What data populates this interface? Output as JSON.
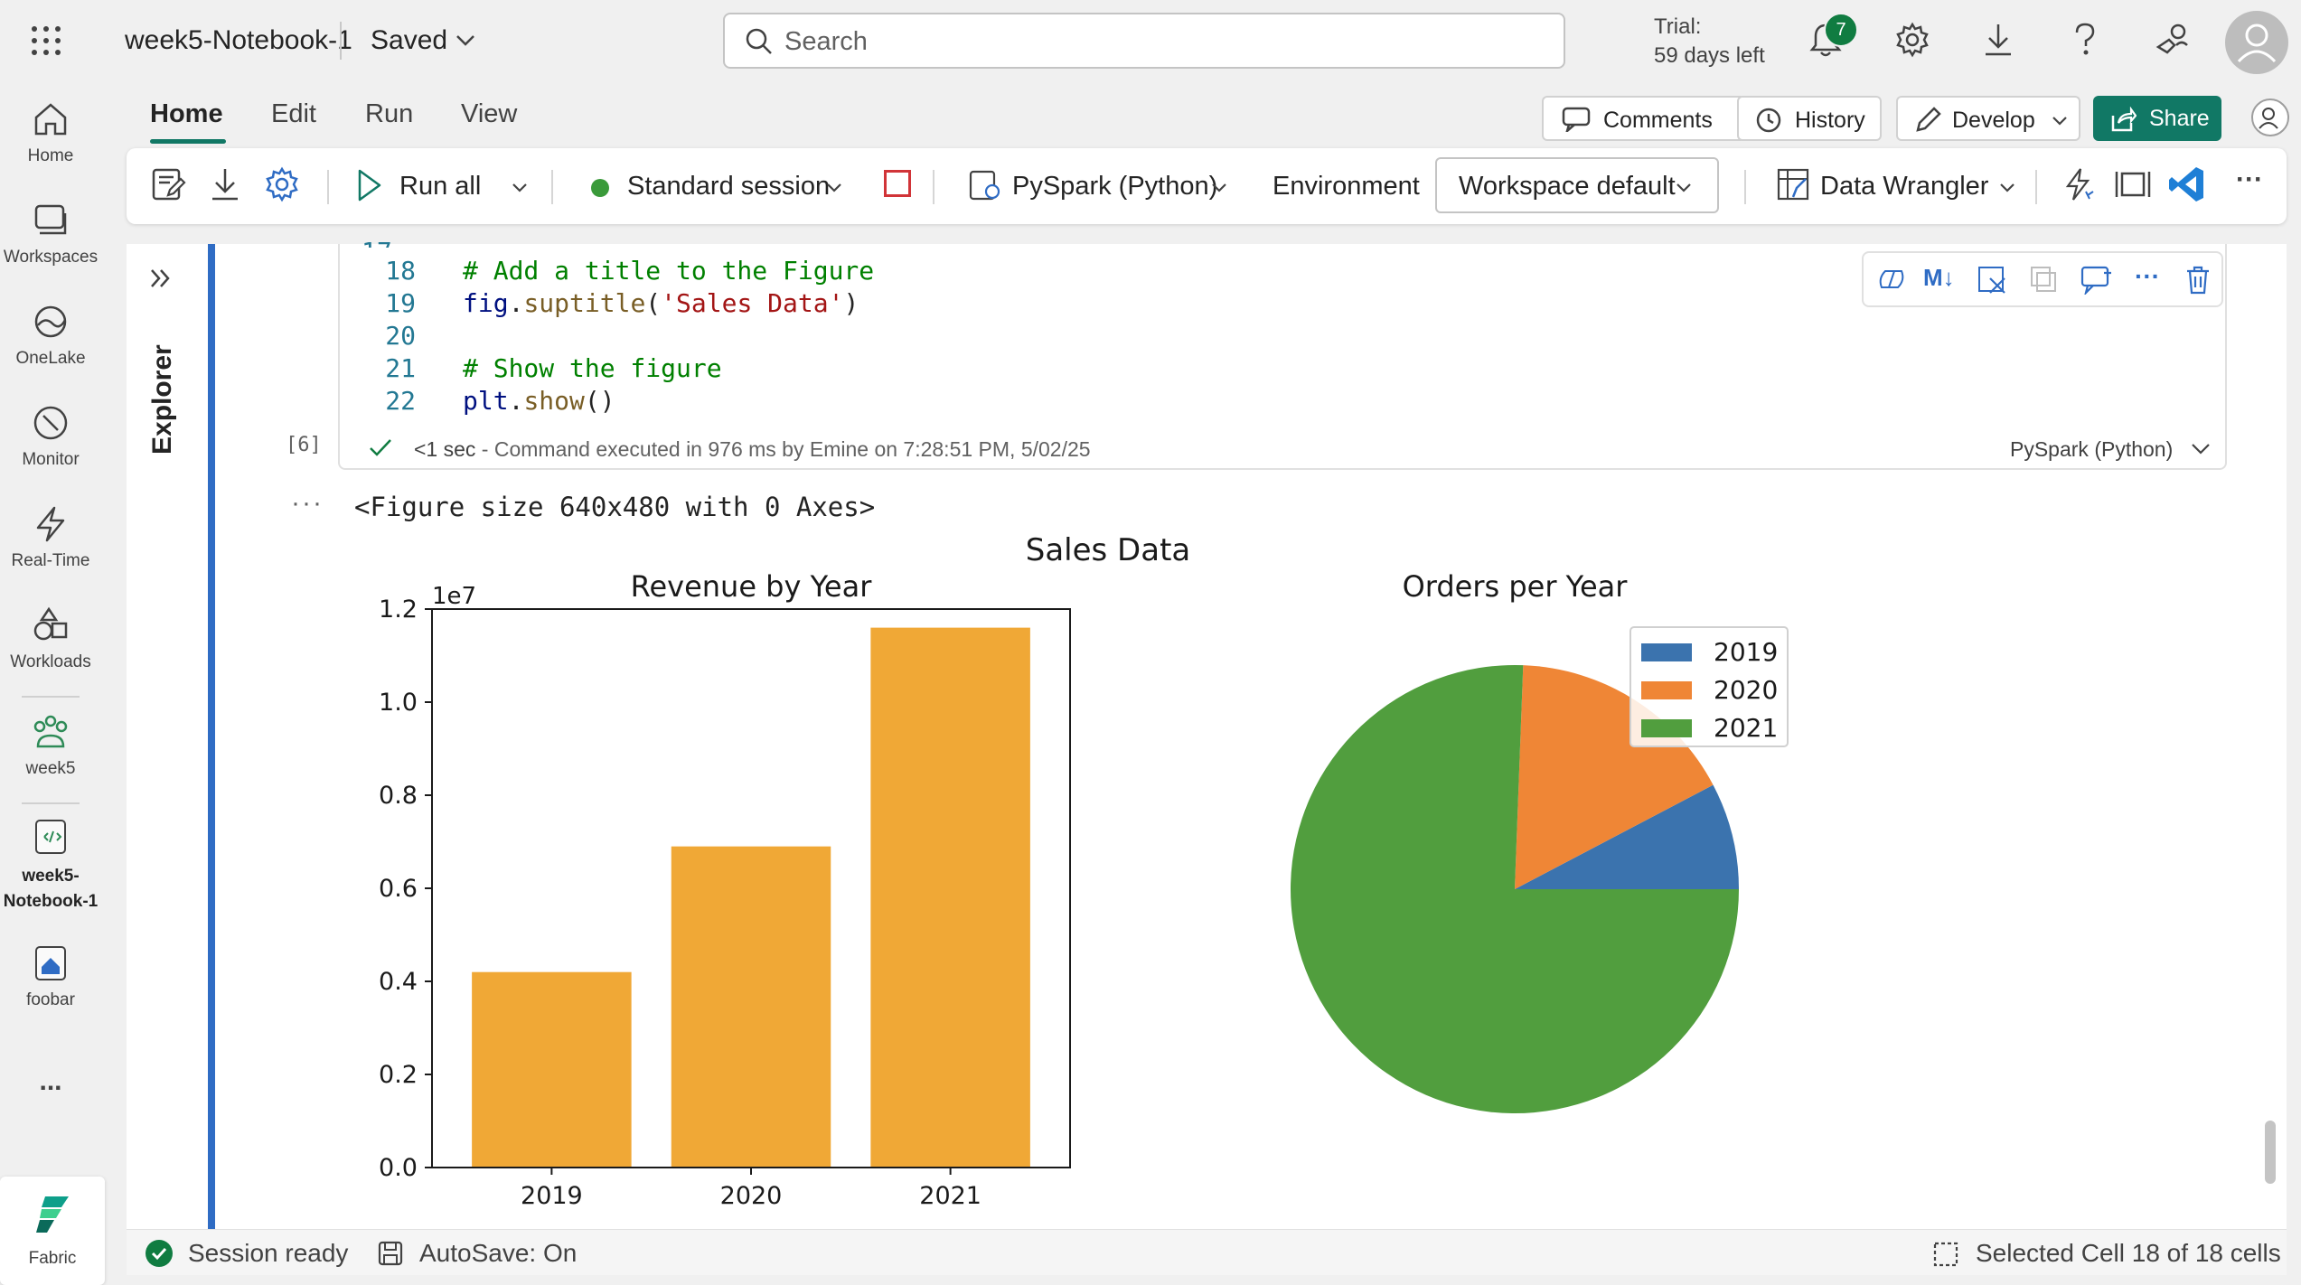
{
  "app": {
    "notebook_name": "week5-Notebook-1",
    "save_state": "Saved",
    "search_placeholder": "Search",
    "trial_line1": "Trial:",
    "trial_line2": "59 days left",
    "notification_count": "7"
  },
  "rail": {
    "items": [
      {
        "label": "Home",
        "icon": "home-icon"
      },
      {
        "label": "Workspaces",
        "icon": "workspaces-icon"
      },
      {
        "label": "OneLake",
        "icon": "onelake-icon"
      },
      {
        "label": "Monitor",
        "icon": "monitor-icon"
      },
      {
        "label": "Real-Time",
        "icon": "realtime-icon"
      },
      {
        "label": "Workloads",
        "icon": "workloads-icon"
      },
      {
        "label": "week5",
        "icon": "workspace-people-icon"
      },
      {
        "label": "week5-\nNotebook-1",
        "icon": "notebook-icon"
      },
      {
        "label": "foobar",
        "icon": "lakehouse-icon"
      }
    ],
    "more": "...",
    "fabric_label": "Fabric"
  },
  "ribbon": {
    "tabs": [
      "Home",
      "Edit",
      "Run",
      "View"
    ],
    "active_tab": "Home",
    "comments": "Comments",
    "history": "History",
    "develop": "Develop",
    "share": "Share"
  },
  "toolbar": {
    "run_all": "Run all",
    "session": "Standard session",
    "language": "PySpark (Python)",
    "environment": "Environment",
    "workspace": "Workspace default",
    "data_wrangler": "Data Wrangler",
    "session_status_color": "#3a9a3a"
  },
  "explorer": {
    "label": "Explorer"
  },
  "cell": {
    "lines": [
      {
        "no": "18",
        "parts": [
          {
            "t": "# Add a title to the Figure",
            "c": "cm"
          }
        ]
      },
      {
        "no": "19",
        "parts": [
          {
            "t": "fig",
            "c": "var"
          },
          {
            "t": ".",
            "c": ""
          },
          {
            "t": "suptitle",
            "c": "fn"
          },
          {
            "t": "(",
            "c": ""
          },
          {
            "t": "'Sales Data'",
            "c": "st"
          },
          {
            "t": ")",
            "c": ""
          }
        ]
      },
      {
        "no": "20",
        "parts": []
      },
      {
        "no": "21",
        "parts": [
          {
            "t": "# Show the figure",
            "c": "cm"
          }
        ]
      },
      {
        "no": "22",
        "parts": [
          {
            "t": "plt",
            "c": "var"
          },
          {
            "t": ".",
            "c": ""
          },
          {
            "t": "show",
            "c": "fn"
          },
          {
            "t": "()",
            "c": ""
          }
        ]
      }
    ],
    "exec_count": "[6]",
    "status_time": "<1 sec",
    "status_text": " - Command executed in 976 ms by Emine on 7:28:51 PM, 5/02/25",
    "language": "PySpark (Python)"
  },
  "output": {
    "dots": "···",
    "text": "<Figure size 640x480 with 0 Axes>"
  },
  "chart_data": [
    {
      "type": "bar",
      "suptitle": "Sales Data",
      "title": "Revenue by Year",
      "categories": [
        "2019",
        "2020",
        "2021"
      ],
      "values": [
        4200000,
        6900000,
        11600000
      ],
      "offset_label": "1e7",
      "ylim": [
        0,
        12000000
      ],
      "yticks": [
        "0.0",
        "0.2",
        "0.4",
        "0.6",
        "0.8",
        "1.0",
        "1.2"
      ],
      "ytick_values": [
        0,
        2000000,
        4000000,
        6000000,
        8000000,
        10000000,
        12000000
      ],
      "color": "#f0a836"
    },
    {
      "type": "pie",
      "title": "Orders per Year",
      "labels": [
        "2019",
        "2020",
        "2021"
      ],
      "values": [
        7.7,
        16.7,
        75.6
      ],
      "colors": [
        "#3b73ae",
        "#ef8636",
        "#519e3e"
      ],
      "legend_position": "upper right"
    }
  ],
  "status": {
    "session": "Session ready",
    "autosave": "AutoSave: On",
    "selection": "Selected Cell 18 of 18 cells"
  }
}
